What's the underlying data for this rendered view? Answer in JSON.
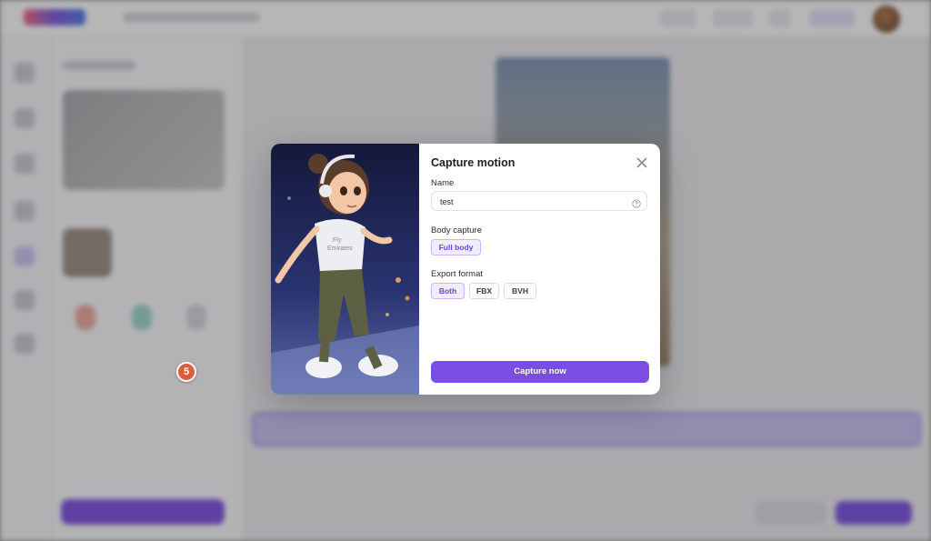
{
  "modal": {
    "title": "Capture motion",
    "name_label": "Name",
    "name_value": "test",
    "body_capture_label": "Body capture",
    "body_capture_option": "Full body",
    "export_format_label": "Export format",
    "export_options": [
      "Both",
      "FBX",
      "BVH"
    ],
    "selected_export": "Both",
    "capture_button": "Capture now",
    "step_badge": "5"
  },
  "icons": {
    "close": "close-icon",
    "help": "help-circle-icon"
  },
  "colors": {
    "accent": "#7b4ee3",
    "selected_chip_bg": "#f1ecfe",
    "step_badge": "#d9603a"
  }
}
